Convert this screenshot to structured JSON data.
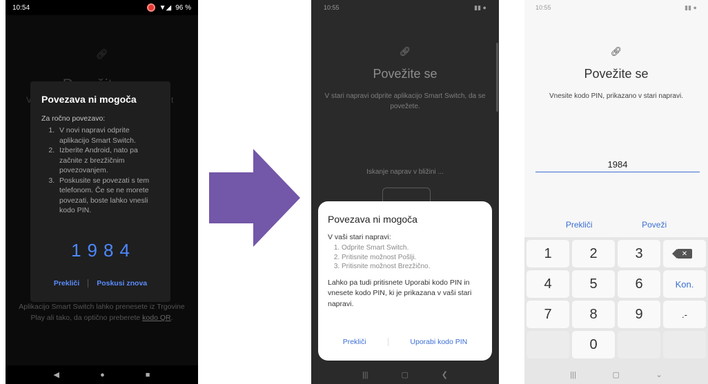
{
  "phone1": {
    "status": {
      "time": "10:54",
      "battery": "96 %"
    },
    "bg_title": "Povežite se",
    "bg_peek_left": "V",
    "bg_peek_right": "t",
    "dialog": {
      "title": "Povezava ni mogoča",
      "intro": "Za ročno povezavo:",
      "steps": [
        "V novi napravi odprite aplikacijo Smart Switch.",
        "Izberite Android, nato pa začnite z brezžičnim povezovanjem.",
        "Poskusite se povezati s tem telefonom. Če se ne morete povezati, boste lahko vnesli kodo PIN."
      ],
      "pin": "1984",
      "cancel": "Prekliči",
      "retry": "Poskusi znova"
    },
    "footer_text": "Aplikacijo Smart Switch lahko prenesete iz Trgovine Play ali tako, da optično preberete",
    "footer_link": "kodo QR",
    "footer_end": "."
  },
  "phone2": {
    "status": {
      "time": "10:55"
    },
    "title": "Povežite se",
    "desc": "V stari napravi odprite aplikacijo Smart Switch, da se povežete.",
    "search": "Iskanje naprav v bližini ...",
    "dialog": {
      "title": "Povezava ni mogoča",
      "intro": "V vaši stari napravi:",
      "steps": [
        "Odprite Smart Switch.",
        "Pritisnite možnost Pošlji.",
        "Pritisnite možnost Brezžično."
      ],
      "note": "Lahko pa tudi pritisnete Uporabi kodo PIN in vnesete kodo PIN, ki je prikazana v vaši stari napravi.",
      "cancel": "Prekliči",
      "use_pin": "Uporabi kodo PIN"
    }
  },
  "phone3": {
    "status": {
      "time": "10:55"
    },
    "title": "Povežite se",
    "desc": "Vnesite kodo PIN, prikazano v stari napravi.",
    "pin_value": "1984",
    "cancel": "Prekliči",
    "connect": "Poveži",
    "keys": [
      "1",
      "2",
      "3",
      "4",
      "5",
      "6",
      "Kon.",
      "7",
      "8",
      "9",
      ".-",
      "0"
    ]
  },
  "colors": {
    "accent": "#3b6ed3",
    "arrow": "#7357a8",
    "pin_blue": "#4d88ff"
  }
}
